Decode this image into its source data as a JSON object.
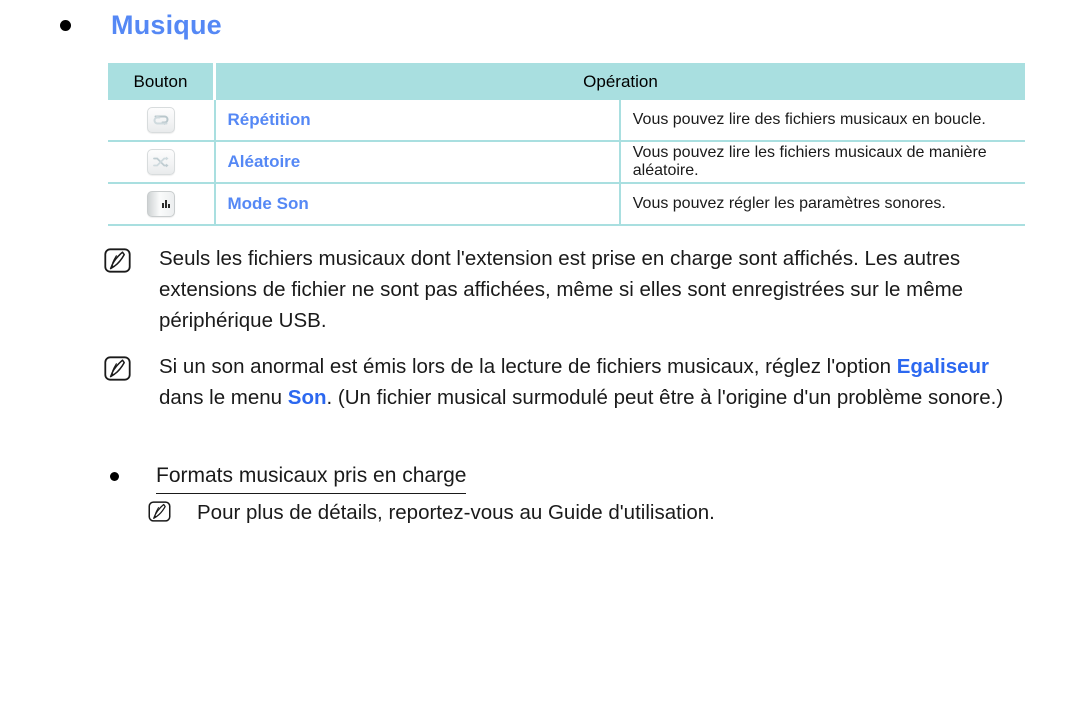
{
  "page": {
    "title": "Musique",
    "title_color": "#5588f5"
  },
  "table": {
    "headers": {
      "button": "Bouton",
      "operation": "Opération"
    },
    "header_bg": "#a9dfe0",
    "rows": [
      {
        "icon": "repeat-key-icon",
        "name": "Répétition",
        "description": "Vous pouvez lire des fichiers musicaux en boucle."
      },
      {
        "icon": "shuffle-key-icon",
        "name": "Aléatoire",
        "description": "Vous pouvez lire les fichiers musicaux de manière aléatoire."
      },
      {
        "icon": "sound-mode-key-icon",
        "name": "Mode Son",
        "description": "Vous pouvez régler les paramètres sonores."
      }
    ]
  },
  "notes": {
    "note_1": "Seuls les fichiers musicaux dont l'extension est prise en charge sont affichés. Les autres extensions de fichier ne sont pas affichées, même si elles sont enregistrées sur le même périphérique USB.",
    "note_2": {
      "part_1": "Si un son anormal est émis lors de la lecture de fichiers musicaux, réglez l'option ",
      "highlight_1": "Egaliseur",
      "part_2": " dans le menu ",
      "highlight_2": "Son",
      "part_3": ". (Un fichier musical surmodulé peut être à l'origine d'un problème sonore.)"
    },
    "note_3": "Pour plus de détails, reportez-vous au Guide d'utilisation."
  },
  "formats": {
    "label": "Formats musicaux pris en charge"
  }
}
